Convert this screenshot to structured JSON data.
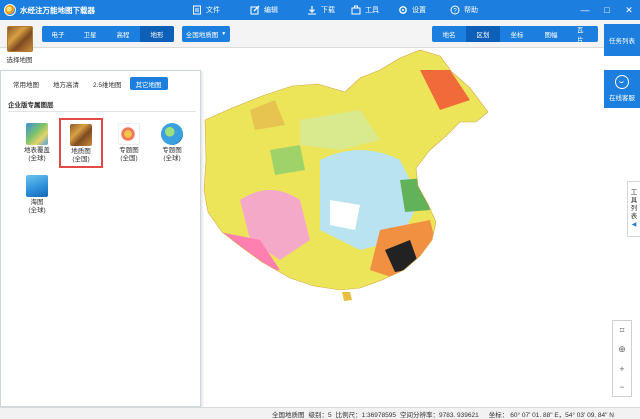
{
  "app": {
    "title": "水经注万能地图下载器",
    "menu": [
      {
        "label": "文件",
        "icon": "file-icon"
      },
      {
        "label": "编辑",
        "icon": "edit-icon"
      },
      {
        "label": "下载",
        "icon": "download-icon"
      },
      {
        "label": "工具",
        "icon": "tools-icon"
      },
      {
        "label": "设置",
        "icon": "settings-icon"
      },
      {
        "label": "帮助",
        "icon": "help-icon"
      }
    ],
    "window_controls": [
      "—",
      "□",
      "✕"
    ]
  },
  "toolbar": {
    "select_map_label": "选择地图",
    "map_types": [
      "电子",
      "卫星",
      "高程",
      "地形"
    ],
    "map_type_active": "地形",
    "map_dropdown": "全国地质图",
    "right_tools": [
      "地名",
      "区划",
      "坐标",
      "图幅",
      "瓦片"
    ],
    "right_tool_active": "区划"
  },
  "right_sidebar": {
    "task_list": "任务列表",
    "online_support": "在线客服",
    "tools_list": [
      "工",
      "具",
      "列",
      "表"
    ]
  },
  "panel": {
    "tabs": [
      "常用地图",
      "地方高清",
      "2.5维地图",
      "其它地图"
    ],
    "active_tab": "其它地图",
    "section_title": "企业版专属图层",
    "items": [
      {
        "line1": "地表覆盖",
        "line2": "(全球)",
        "icon": "land-cover-icon",
        "selected": false
      },
      {
        "line1": "地质图",
        "line2": "(全国)",
        "icon": "geology-icon",
        "selected": true
      },
      {
        "line1": "专题图",
        "line2": "(全国)",
        "icon": "thematic-china-icon",
        "selected": false
      },
      {
        "line1": "专题图",
        "line2": "(全球)",
        "icon": "thematic-globe-icon",
        "selected": false
      },
      {
        "line1": "海图",
        "line2": "(全球)",
        "icon": "sea-chart-icon",
        "selected": false
      }
    ]
  },
  "status": {
    "map_name": "全国地质图",
    "level_label": "级别：5",
    "scale_label": "比例尺：1:36978595",
    "resolution_label": "空间分辨率：9783. 939621",
    "coord_label": "坐标：",
    "coord_value": "60° 07' 01. 88\" E，54° 03' 09. 84\" N"
  },
  "zoom_controls": [
    "⌗",
    "⊕",
    "+",
    "−"
  ],
  "colors": {
    "brand_blue": "#1c7fe0",
    "active_blue": "#0d5fb8",
    "selection_red": "#e24a43"
  }
}
